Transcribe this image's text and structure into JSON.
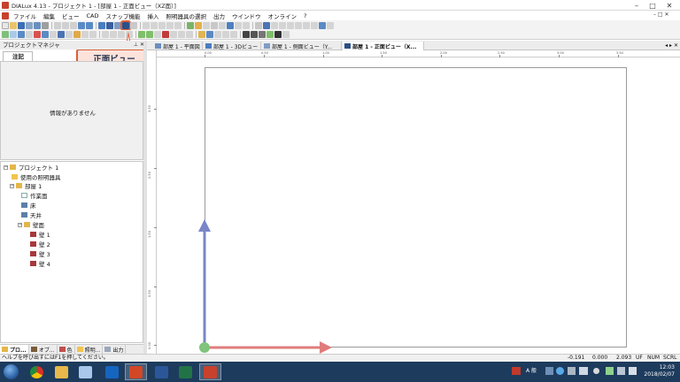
{
  "window": {
    "title": "DIALux 4.13 - プロジェクト 1 - [部屋 1 - 正面ビュー（XZ面）]",
    "controls": {
      "minimize": "–",
      "maximize": "□",
      "close": "✕"
    }
  },
  "menubar": {
    "items": [
      "ファイル",
      "編集",
      "ビュー",
      "CAD",
      "スナップ機能",
      "挿入",
      "照明器具の選択",
      "出力",
      "ウインドウ",
      "オンライン",
      "?"
    ],
    "mdi_controls": "– □ ✕"
  },
  "callout": {
    "label": "正面ビュー"
  },
  "project_manager": {
    "title": "プロジェクトマネジャ",
    "pin": "⊥",
    "close": "✕",
    "notes_tab": "注記",
    "notes_empty": "情報がありません",
    "tree": [
      {
        "label": "プロジェクト 1",
        "toggle": "−"
      },
      {
        "label": "使用の照明器具"
      },
      {
        "label": "部屋 1",
        "toggle": "−"
      },
      {
        "label": "作業面"
      },
      {
        "label": "床"
      },
      {
        "label": "天井"
      },
      {
        "label": "壁面",
        "toggle": "−"
      },
      {
        "label": "壁 1"
      },
      {
        "label": "壁 2"
      },
      {
        "label": "壁 3"
      },
      {
        "label": "壁 4"
      }
    ],
    "bottom_tabs": [
      "プロ...",
      "オブ...",
      "色",
      "照明...",
      "出力"
    ]
  },
  "doc_tabs": {
    "tabs": [
      "部屋 1 - 平面図",
      "部屋 1 - 3Dビュー",
      "部屋 1 - 側面ビュー（Y...",
      "部屋 1 - 正面ビュー（X..."
    ],
    "active_index": 3,
    "nav": "◂ ▸ ✕"
  },
  "rulers": {
    "top": [
      "0.00",
      "0.50",
      "1.00",
      "1.50",
      "2.00",
      "2.50",
      "3.00",
      "3.50"
    ],
    "left": [
      "3.50",
      "2.50",
      "1.50",
      "0.50",
      "0.00"
    ]
  },
  "statusbar": {
    "help": "ヘルプを呼び出すにはF1を押してください。",
    "x": "-0.191",
    "y": "0.000",
    "z": "2.093",
    "uf": "UF",
    "num": "NUM",
    "scrl": "SCRL"
  },
  "taskbar": {
    "ime": "A 般",
    "clock_time": "12:03",
    "clock_date": "2018/02/07",
    "colors": {
      "bg": "#1d3b5d"
    }
  },
  "colors": {
    "accent_callout": "#d9603a",
    "axis_z": "#7a86c8",
    "axis_x": "#e07c7c",
    "origin": "#80c47d"
  }
}
